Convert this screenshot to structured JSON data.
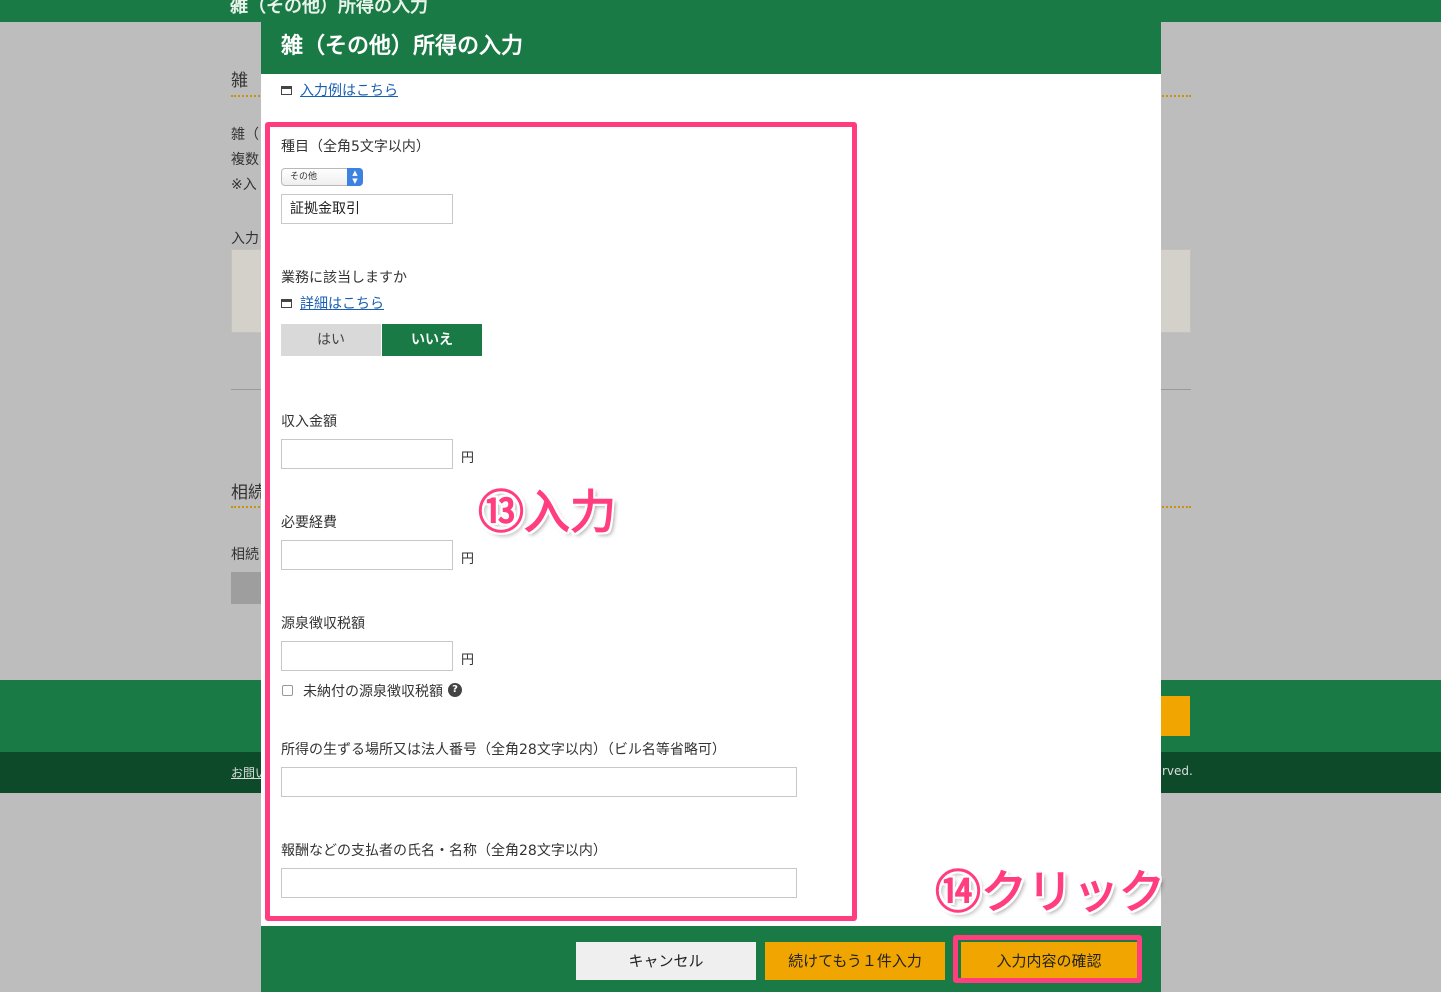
{
  "background": {
    "top_title": "雑（その他）所得の入力",
    "section1_heading": "雑",
    "section1_lines": [
      "雑（",
      "複数",
      "※入"
    ],
    "section1_subheading": "入力",
    "section2_heading": "相続",
    "section2_text": "相続",
    "footer_link": "お問い",
    "footer_copyright": "rved."
  },
  "modal": {
    "title": "雑（その他）所得の入力",
    "example_link": "入力例はこちら",
    "category": {
      "label": "種目（全角5文字以内）",
      "select_value": "その他",
      "input_value": "証拠金取引"
    },
    "business": {
      "label": "業務に該当しますか",
      "detail_link": "詳細はこちら",
      "yes_label": "はい",
      "no_label": "いいえ"
    },
    "income": {
      "label": "収入金額",
      "value": "",
      "unit": "円"
    },
    "expenses": {
      "label": "必要経費",
      "value": "",
      "unit": "円"
    },
    "withholding": {
      "label": "源泉徴収税額",
      "value": "",
      "unit": "円",
      "unpaid_checkbox_label": "未納付の源泉徴収税額",
      "help_icon": "?"
    },
    "location": {
      "label": "所得の生ずる場所又は法人番号（全角28文字以内）（ビル名等省略可）",
      "value": ""
    },
    "payer": {
      "label": "報酬などの支払者の氏名・名称（全角28文字以内）",
      "value": ""
    },
    "footer": {
      "cancel_label": "キャンセル",
      "continue_label": "続けてもう１件入力",
      "confirm_label": "入力内容の確認"
    }
  },
  "annotations": {
    "step13": "⑬入力",
    "step14": "⑭クリック"
  },
  "colors": {
    "brand_green": "#1a7a45",
    "accent_orange": "#f0a500",
    "annotation_pink": "#ff3d7f"
  }
}
